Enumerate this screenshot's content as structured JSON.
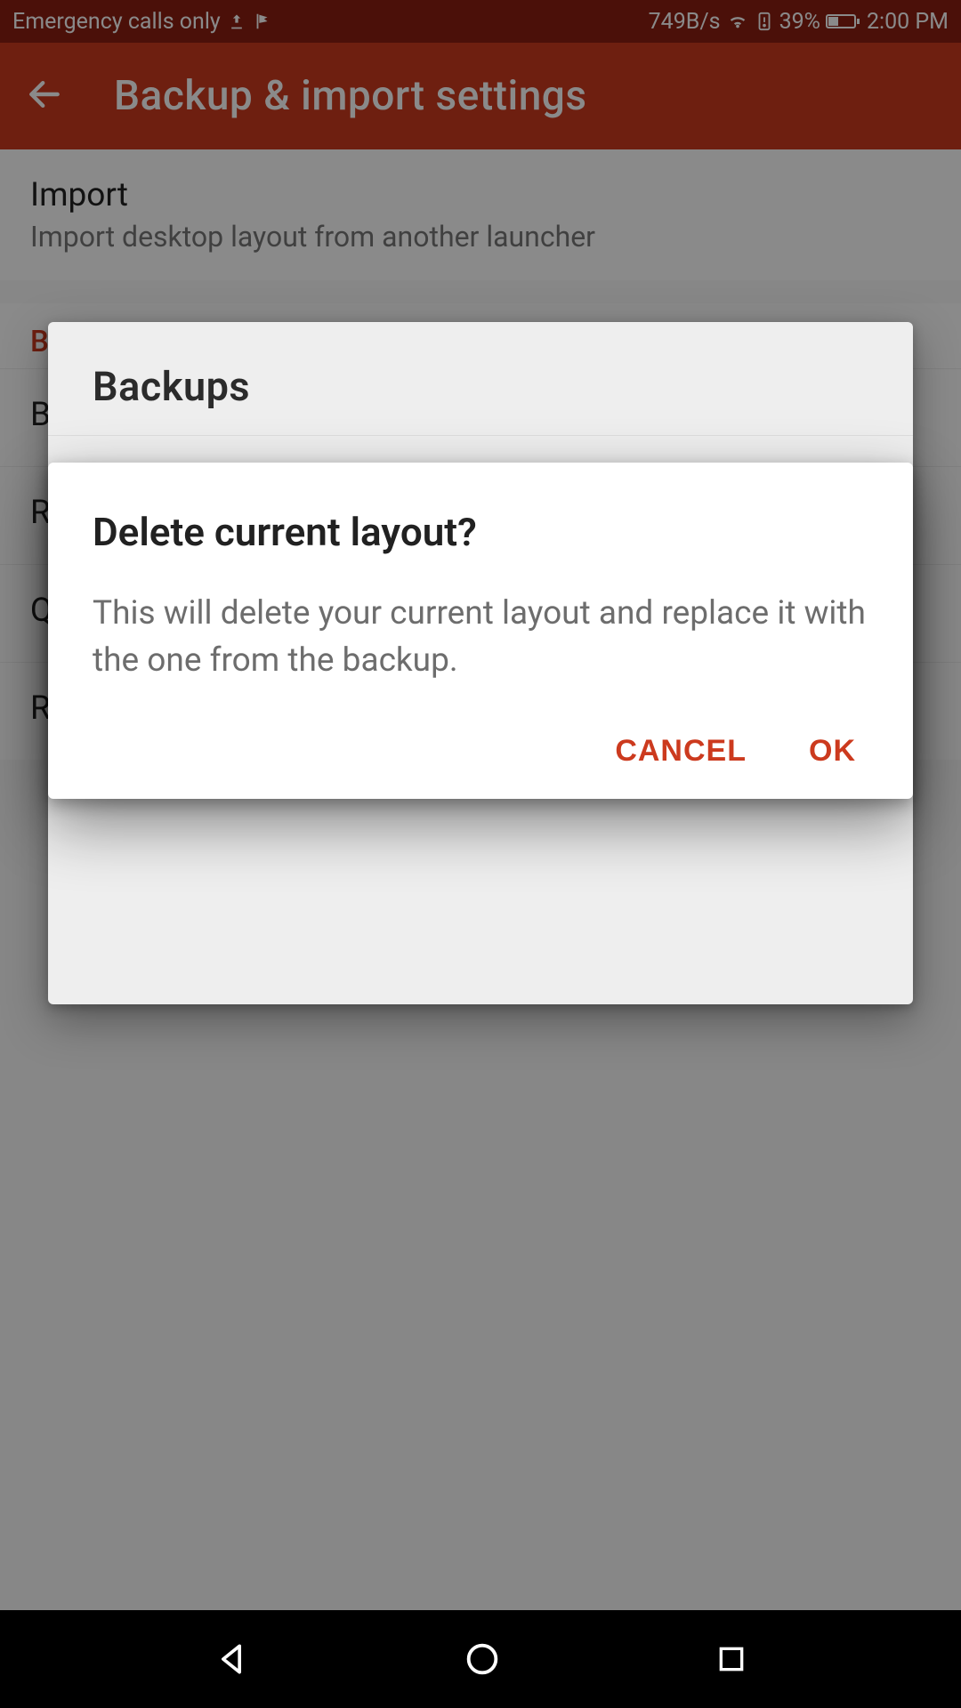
{
  "colors": {
    "accent": "#cc3a1e",
    "statusbar": "#8b1f12"
  },
  "status": {
    "left_text": "Emergency calls only",
    "network_speed": "749B/s",
    "battery_pct": "39%",
    "time": "2:00 PM"
  },
  "appbar": {
    "title": "Backup & import settings"
  },
  "list": {
    "import": {
      "title": "Import",
      "subtitle": "Import desktop layout from another launcher"
    },
    "backup_heading": "B",
    "rows": [
      {
        "label": "B"
      },
      {
        "label": "R"
      },
      {
        "label": "Q"
      },
      {
        "label": "R"
      }
    ]
  },
  "sheet": {
    "title": "Backups"
  },
  "dialog": {
    "title": "Delete current layout?",
    "body": "This will delete your current layout and replace it with the one from the backup.",
    "cancel": "CANCEL",
    "ok": "OK"
  }
}
